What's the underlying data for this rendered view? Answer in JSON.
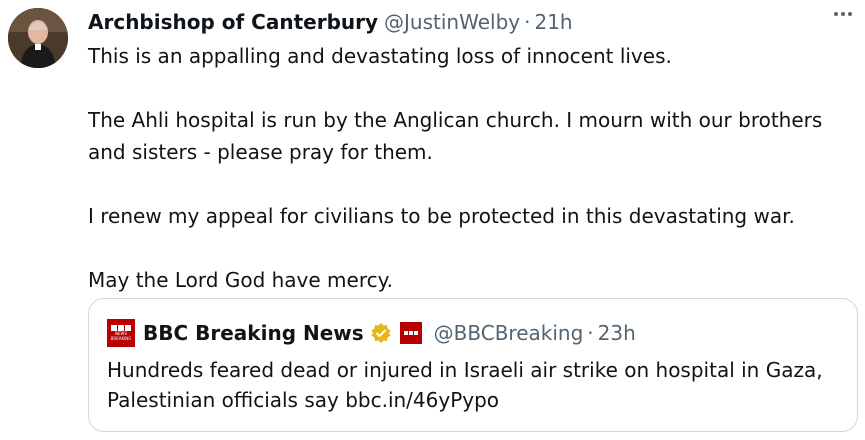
{
  "author": {
    "display_name": "Archbishop of Canterbury",
    "handle": "@JustinWelby",
    "separator": "·",
    "time": "21h"
  },
  "tweet": {
    "paragraphs": [
      "This is an appalling and devastating loss of innocent lives.",
      "The Ahli hospital is run by the Anglican church. I mourn with our brothers and sisters - please pray for them.",
      "I renew my appeal for civilians to be protected in this devastating war.",
      "May the Lord God have mercy."
    ]
  },
  "quoted": {
    "display_name": "BBC Breaking News",
    "handle": "@BBCBreaking",
    "separator": "·",
    "time": "23h",
    "text": "Hundreds feared dead or injured in Israeli air strike on hospital in Gaza, Palestinian officials say bbc.in/46yPypo",
    "logo_text": "NEWS",
    "logo_subtext": "BREAKING"
  },
  "icons": {
    "more": "more-icon",
    "verified": "gold-verified-badge-icon",
    "affiliate": "bbc-affiliate-badge-icon"
  },
  "colors": {
    "text": "#0f1419",
    "secondary": "#536471",
    "border": "#cfd9de",
    "bbc_red": "#b80000",
    "verified_gold": "#e2b719"
  }
}
